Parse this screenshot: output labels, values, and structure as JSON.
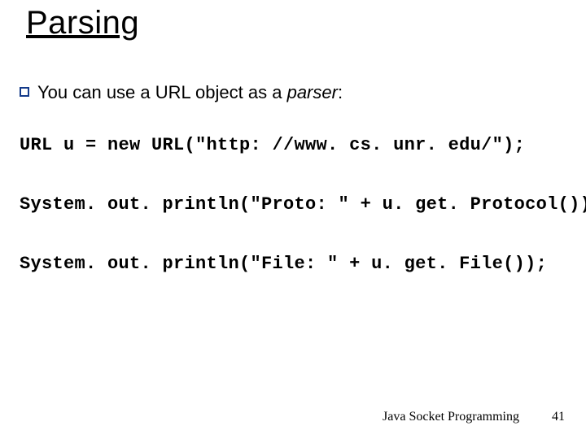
{
  "title": "Parsing",
  "bullet": {
    "prefix": "You can use a URL object as a ",
    "italic_word": "parser",
    "suffix": ":"
  },
  "code": {
    "line1": "URL u = new URL(\"http: //www. cs. unr. edu/\");",
    "line2": "System. out. println(\"Proto: \" + u. get. Protocol());",
    "line3": "System. out. println(\"File: \" + u. get. File());"
  },
  "footer": {
    "label": "Java Socket Programming",
    "page": "41"
  }
}
